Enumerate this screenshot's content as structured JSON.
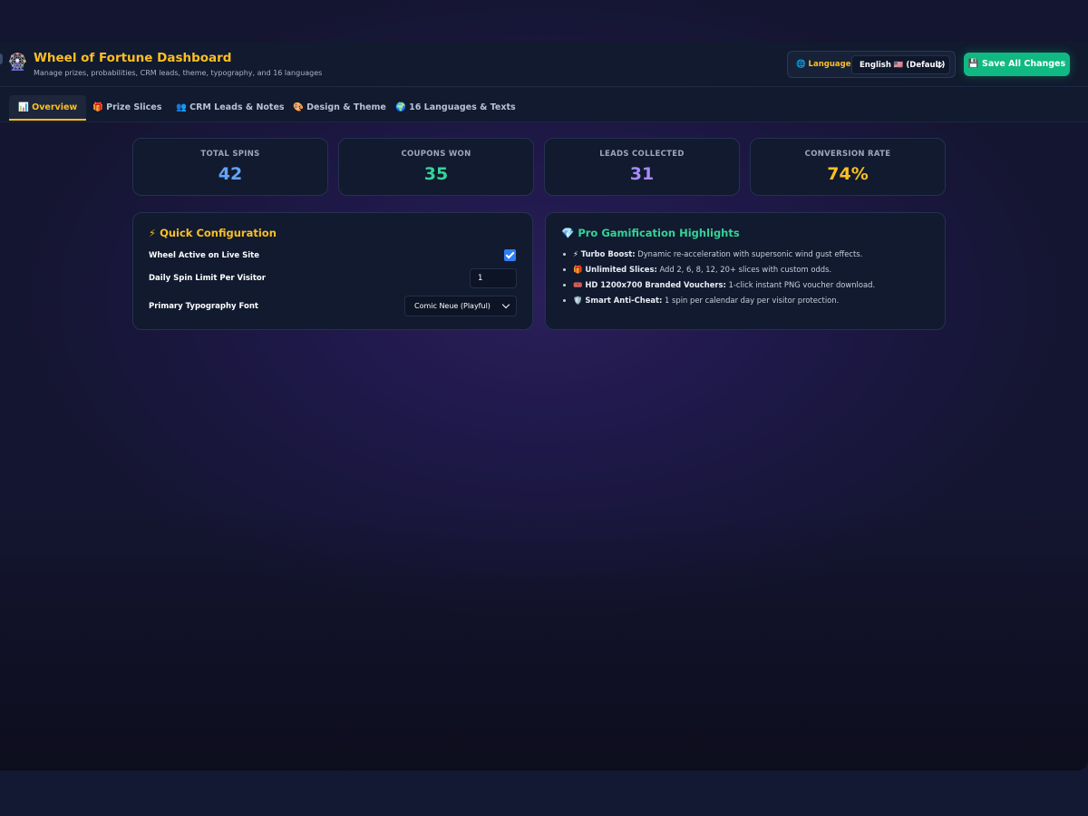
{
  "header": {
    "logo_icon": "🎡",
    "title": "Wheel of Fortune Dashboard",
    "subtitle": "Manage prizes, probabilities, CRM leads, theme, typography, and 16 languages",
    "language_label": "🌐 Language:",
    "language_value": "English 🇺🇸 (Default)",
    "save_label": "💾 Save All Changes"
  },
  "tabs": [
    {
      "label": "📊 Overview",
      "active": true
    },
    {
      "label": "🎁 Prize Slices",
      "active": false
    },
    {
      "label": "👥 CRM Leads & Notes",
      "active": false
    },
    {
      "label": "🎨 Design & Theme",
      "active": false
    },
    {
      "label": "🌍 16 Languages & Texts",
      "active": false
    }
  ],
  "stats": [
    {
      "label": "TOTAL SPINS",
      "value": "42",
      "color": "#60a5fa"
    },
    {
      "label": "COUPONS WON",
      "value": "35",
      "color": "#34d399"
    },
    {
      "label": "LEADS COLLECTED",
      "value": "31",
      "color": "#a78bfa"
    },
    {
      "label": "CONVERSION RATE",
      "value": "74%",
      "color": "#fbbf24"
    }
  ],
  "quick_config": {
    "title": "⚡ Quick Configuration",
    "wheel_active_label": "Wheel Active on Live Site",
    "wheel_active_checked": true,
    "spin_limit_label": "Daily Spin Limit Per Visitor",
    "spin_limit_value": "1",
    "font_label": "Primary Typography Font",
    "font_value": "Comic Neue (Playful)"
  },
  "highlights": {
    "title": "💎 Pro Gamification Highlights",
    "items": [
      {
        "name": "⚡ Turbo Boost:",
        "text": " Dynamic re-acceleration with supersonic wind gust effects."
      },
      {
        "name": "🎁 Unlimited Slices:",
        "text": " Add 2, 6, 8, 12, 20+ slices with custom odds."
      },
      {
        "name": "🎟️ HD 1200x700 Branded Vouchers:",
        "text": " 1-click instant PNG voucher download."
      },
      {
        "name": "🛡️ Smart Anti-Cheat:",
        "text": " 1 spin per calendar day per visitor protection."
      }
    ]
  },
  "colors": {
    "accent": "#fbbf24",
    "save_button": "#10b981",
    "highlights_title": "#34d399"
  }
}
